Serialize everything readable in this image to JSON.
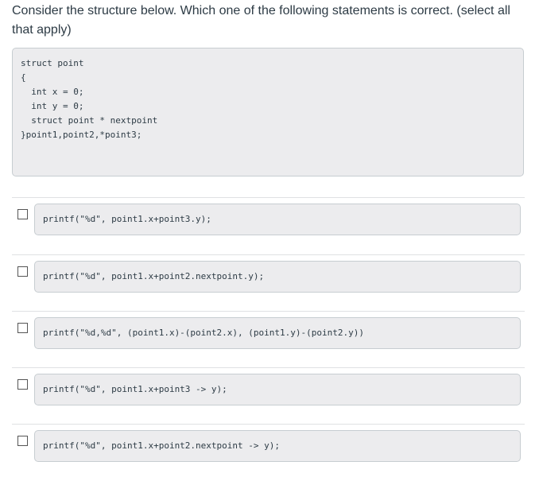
{
  "question": "Consider the structure below. Which one of the following statements is correct. (select all that apply)",
  "code": "struct point\n{\n  int x = 0;\n  int y = 0;\n  struct point * nextpoint\n}point1,point2,*point3;",
  "options": [
    {
      "label": "printf(\"%d\", point1.x+point3.y);",
      "checked": false
    },
    {
      "label": "printf(\"%d\", point1.x+point2.nextpoint.y);",
      "checked": false
    },
    {
      "label": "printf(\"%d,%d\", (point1.x)-(point2.x), (point1.y)-(point2.y))",
      "checked": false
    },
    {
      "label": "printf(\"%d\", point1.x+point3 -> y);",
      "checked": false
    },
    {
      "label": "printf(\"%d\", point1.x+point2.nextpoint -> y);",
      "checked": false
    }
  ]
}
